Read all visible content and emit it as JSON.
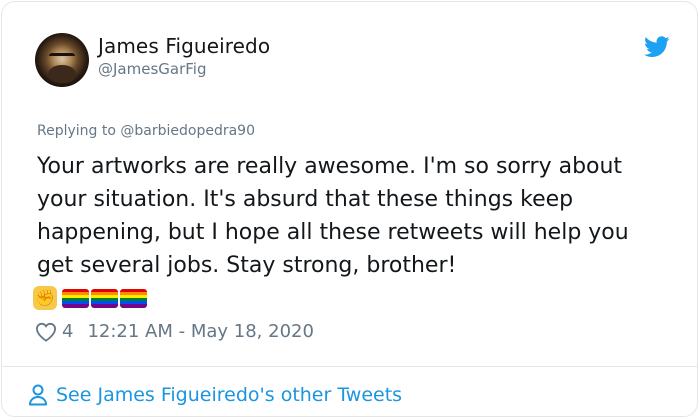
{
  "tweet": {
    "author_name": "James Figueiredo",
    "author_handle": "@JamesGarFig",
    "replying_prefix": "Replying to ",
    "replying_to": "@barbiedopedra90",
    "text": "Your artworks are really awesome. I'm so sorry about your situation. It's absurd that these things keep happening, but I hope all these retweets will help you get several jobs. Stay strong, brother!",
    "emojis": [
      "raised-fist",
      "rainbow-flag",
      "rainbow-flag",
      "rainbow-flag"
    ],
    "likes": "4",
    "timestamp": "12:21 AM - May 18, 2020"
  },
  "footer": {
    "see_more": "See James Figueiredo's other Tweets"
  },
  "colors": {
    "text": "#14171a",
    "secondary": "#657786",
    "link": "#1b95e0",
    "twitter_blue": "#1da1f2",
    "border": "#e1e8ed"
  },
  "icons": [
    "avatar",
    "twitter-bird-icon",
    "heart-icon",
    "person-icon"
  ]
}
